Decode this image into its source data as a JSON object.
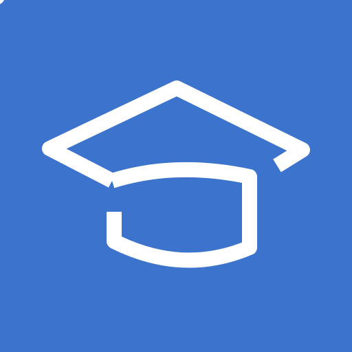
{
  "icon": {
    "name": "graduation-cap-icon",
    "background_color": "#3c73cc",
    "foreground_color": "#ffffff"
  }
}
